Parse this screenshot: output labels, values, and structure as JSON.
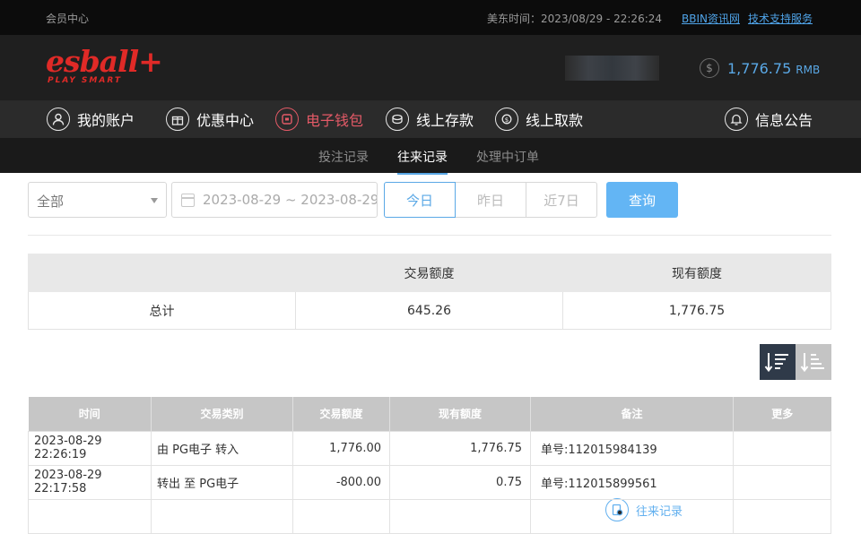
{
  "topbar": {
    "member_center": "会员中心",
    "time_label": "美东时间：2023/08/29 - 22:26:24",
    "link_bbin": "BBIN资讯网",
    "link_support": "技术支持服务"
  },
  "header": {
    "logo_main": "esball+",
    "logo_sub": "PLAY SMART",
    "balance": "1,776.75",
    "currency": "RMB"
  },
  "nav": {
    "items": [
      {
        "label": "我的账户",
        "icon": "user-icon"
      },
      {
        "label": "优惠中心",
        "icon": "gift-icon"
      },
      {
        "label": "电子钱包",
        "icon": "wallet-icon"
      },
      {
        "label": "线上存款",
        "icon": "deposit-icon"
      },
      {
        "label": "线上取款",
        "icon": "withdraw-icon"
      },
      {
        "label": "往来记录",
        "icon": "records-icon"
      },
      {
        "label": "信息公告",
        "icon": "bell-icon"
      }
    ]
  },
  "subnav": {
    "tabs": [
      "投注记录",
      "往来记录",
      "处理中订单"
    ]
  },
  "filters": {
    "type_selected": "全部",
    "date_range": "2023-08-29 ~ 2023-08-29",
    "today": "今日",
    "yesterday": "昨日",
    "last7": "近7日",
    "query": "查询"
  },
  "summary": {
    "headers": [
      "",
      "交易额度",
      "现有额度"
    ],
    "row": [
      "总计",
      "645.26",
      "1,776.75"
    ]
  },
  "records": {
    "headers": [
      "时间",
      "交易类别",
      "交易额度",
      "现有额度",
      "备注",
      "更多"
    ],
    "rows": [
      [
        "2023-08-29 22:26:19",
        "由 PG电子 转入",
        "1,776.00",
        "1,776.75",
        "单号:112015984139",
        ""
      ],
      [
        "2023-08-29 22:17:58",
        "转出 至 PG电子",
        "-800.00",
        "0.75",
        "单号:112015899561",
        ""
      ]
    ]
  }
}
